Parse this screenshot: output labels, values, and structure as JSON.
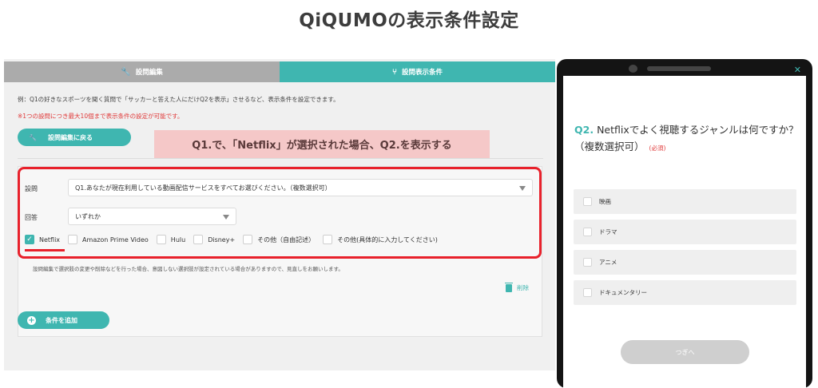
{
  "page": {
    "title": "QiQUMOの表示条件設定"
  },
  "tabs": [
    {
      "label": "設問編集",
      "icon": "wrench-icon",
      "active": false
    },
    {
      "label": "設問表示条件",
      "icon": "branch-icon",
      "active": true
    }
  ],
  "editor": {
    "intro": "例：Q1の好きなスポーツを聞く質問で「サッカーと答えた人にだけQ2を表示」させるなど、表示条件を設定できます。",
    "limit_note": "※1つの設問につき最大10個まで表示条件の設定が可能です。",
    "back_button": "設問編集に戻る",
    "annotation": "Q1.で、「Netflix」が選択された場合、Q2.を表示する",
    "question_label": "設問",
    "question_value": "Q1.あなたが現在利用している動画配信サービスをすべてお選びください。（複数選択可）",
    "answer_label": "回答",
    "answer_value": "いずれか",
    "options": [
      {
        "label": "Netflix",
        "checked": true
      },
      {
        "label": "Amazon Prime Video",
        "checked": false
      },
      {
        "label": "Hulu",
        "checked": false
      },
      {
        "label": "Disney+",
        "checked": false
      },
      {
        "label": "その他（自由記述）",
        "checked": false
      },
      {
        "label": "その他(具体的に入力してください)",
        "checked": false
      }
    ],
    "warning": "設問編集で選択肢の変更や削除などを行った場合、意図しない選択肢が設定されている場合がありますので、見直しをお願いします。",
    "delete_label": "削除",
    "add_button": "条件を追加"
  },
  "preview": {
    "question_number": "Q2.",
    "question_text": "Netflixでよく視聴するジャンルは何ですか？（複数選択可）",
    "required": "(必須)",
    "choices": [
      "映画",
      "ドラマ",
      "アニメ",
      "ドキュメンタリー"
    ],
    "next_button": "つぎへ",
    "close_glyph": "✕"
  },
  "colors": {
    "accent": "#3fb6b0",
    "highlight": "#e8212b",
    "annotation_bg": "#f5c8c8",
    "tab_inactive": "#ababab"
  }
}
